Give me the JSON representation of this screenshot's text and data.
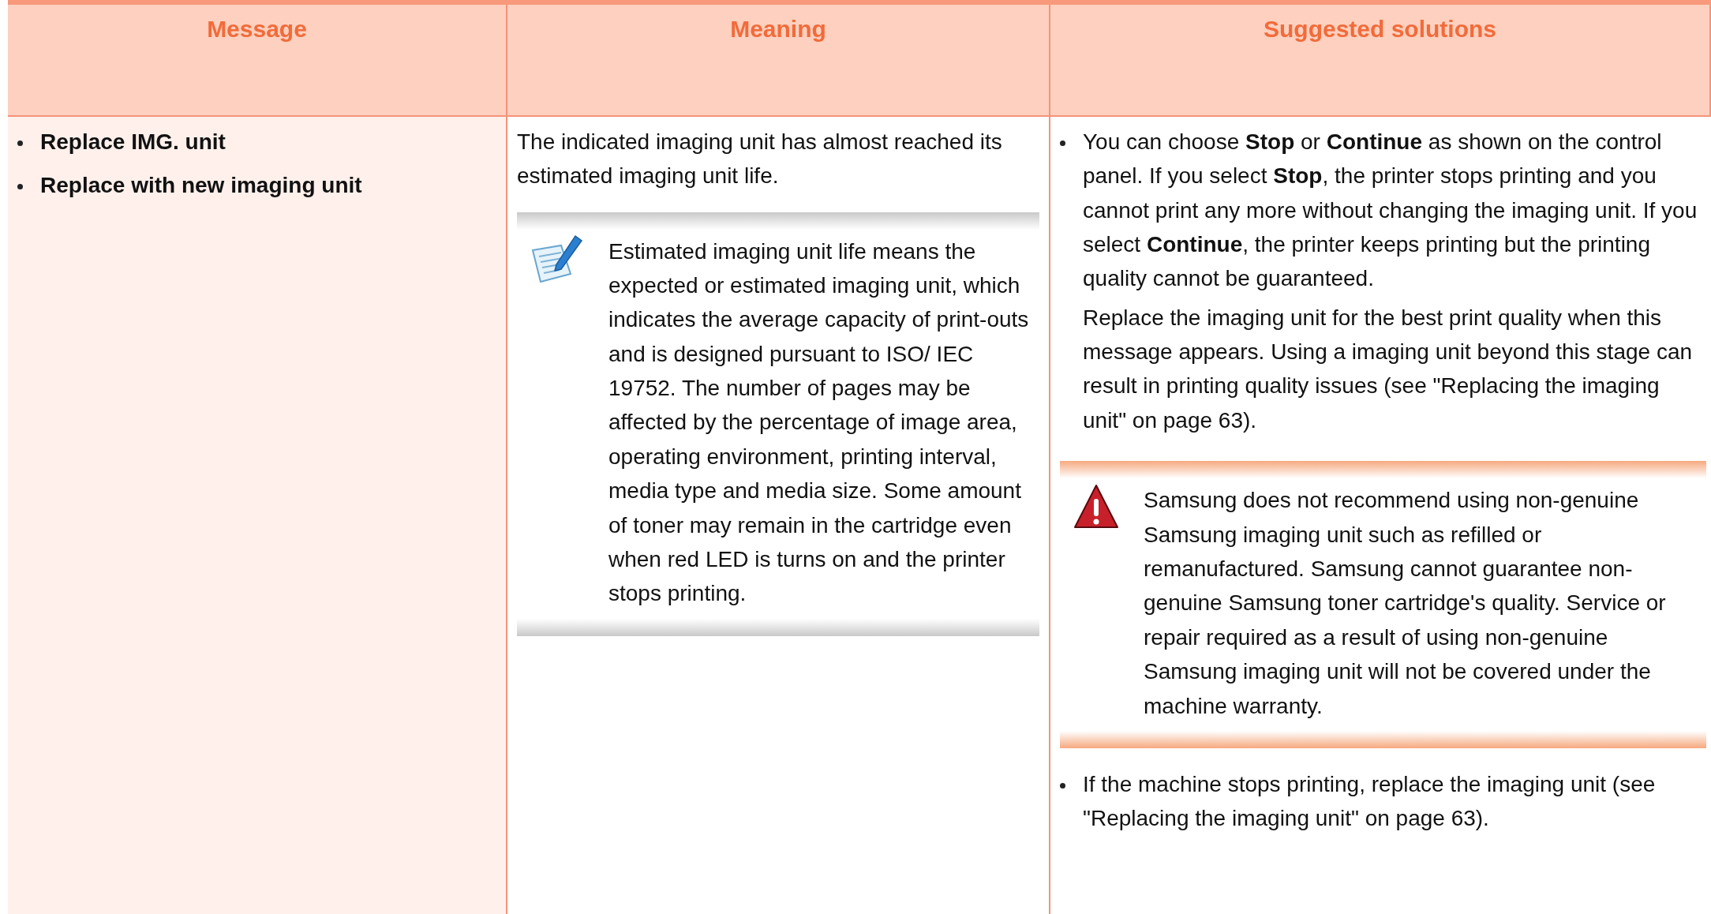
{
  "table": {
    "columns": [
      "Message",
      "Meaning",
      "Suggested solutions"
    ],
    "rows": [
      {
        "message": [
          "Replace IMG. unit",
          "Replace with new imaging unit"
        ],
        "meaning": [
          {
            "kind": "text",
            "paragraphs": [
              "The indicated imaging unit has almost reached its estimated imaging unit life."
            ]
          },
          {
            "kind": "note",
            "text": "Estimated imaging unit life means the expected or estimated imaging unit, which indicates the average capacity of print-outs and is designed pursuant to ISO/ IEC 19752. The number of pages may be affected by the percentage of image area, operating environment, printing interval, media type and media size. Some amount of toner may remain in the cartridge even when red LED is turns on and the printer stops printing."
          }
        ],
        "solutions": [
          {
            "kind": "bullet",
            "paragraphs": [
              "You can choose **Stop** or **Continue** as shown on the control panel. If you select **Stop**, the printer stops printing and you cannot print any more without changing the imaging unit. If you select **Continue**, the printer keeps printing but the printing quality cannot be guaranteed.",
              "Replace the imaging unit for the best print quality when this message appears. Using a imaging unit beyond this stage can result in printing quality issues (see \"Replacing the imaging unit\" on page 63)."
            ]
          },
          {
            "kind": "warning",
            "text": "Samsung does not recommend using non-genuine Samsung imaging unit such as refilled or remanufactured. Samsung cannot guarantee non-genuine Samsung toner cartridge's quality. Service or repair required as a result of using non-genuine Samsung imaging unit will not be covered under the machine warranty."
          },
          {
            "kind": "bullet",
            "paragraphs": [
              "If the machine stops printing, replace the imaging unit (see \"Replacing the imaging unit\" on page 63)."
            ]
          }
        ]
      }
    ]
  }
}
